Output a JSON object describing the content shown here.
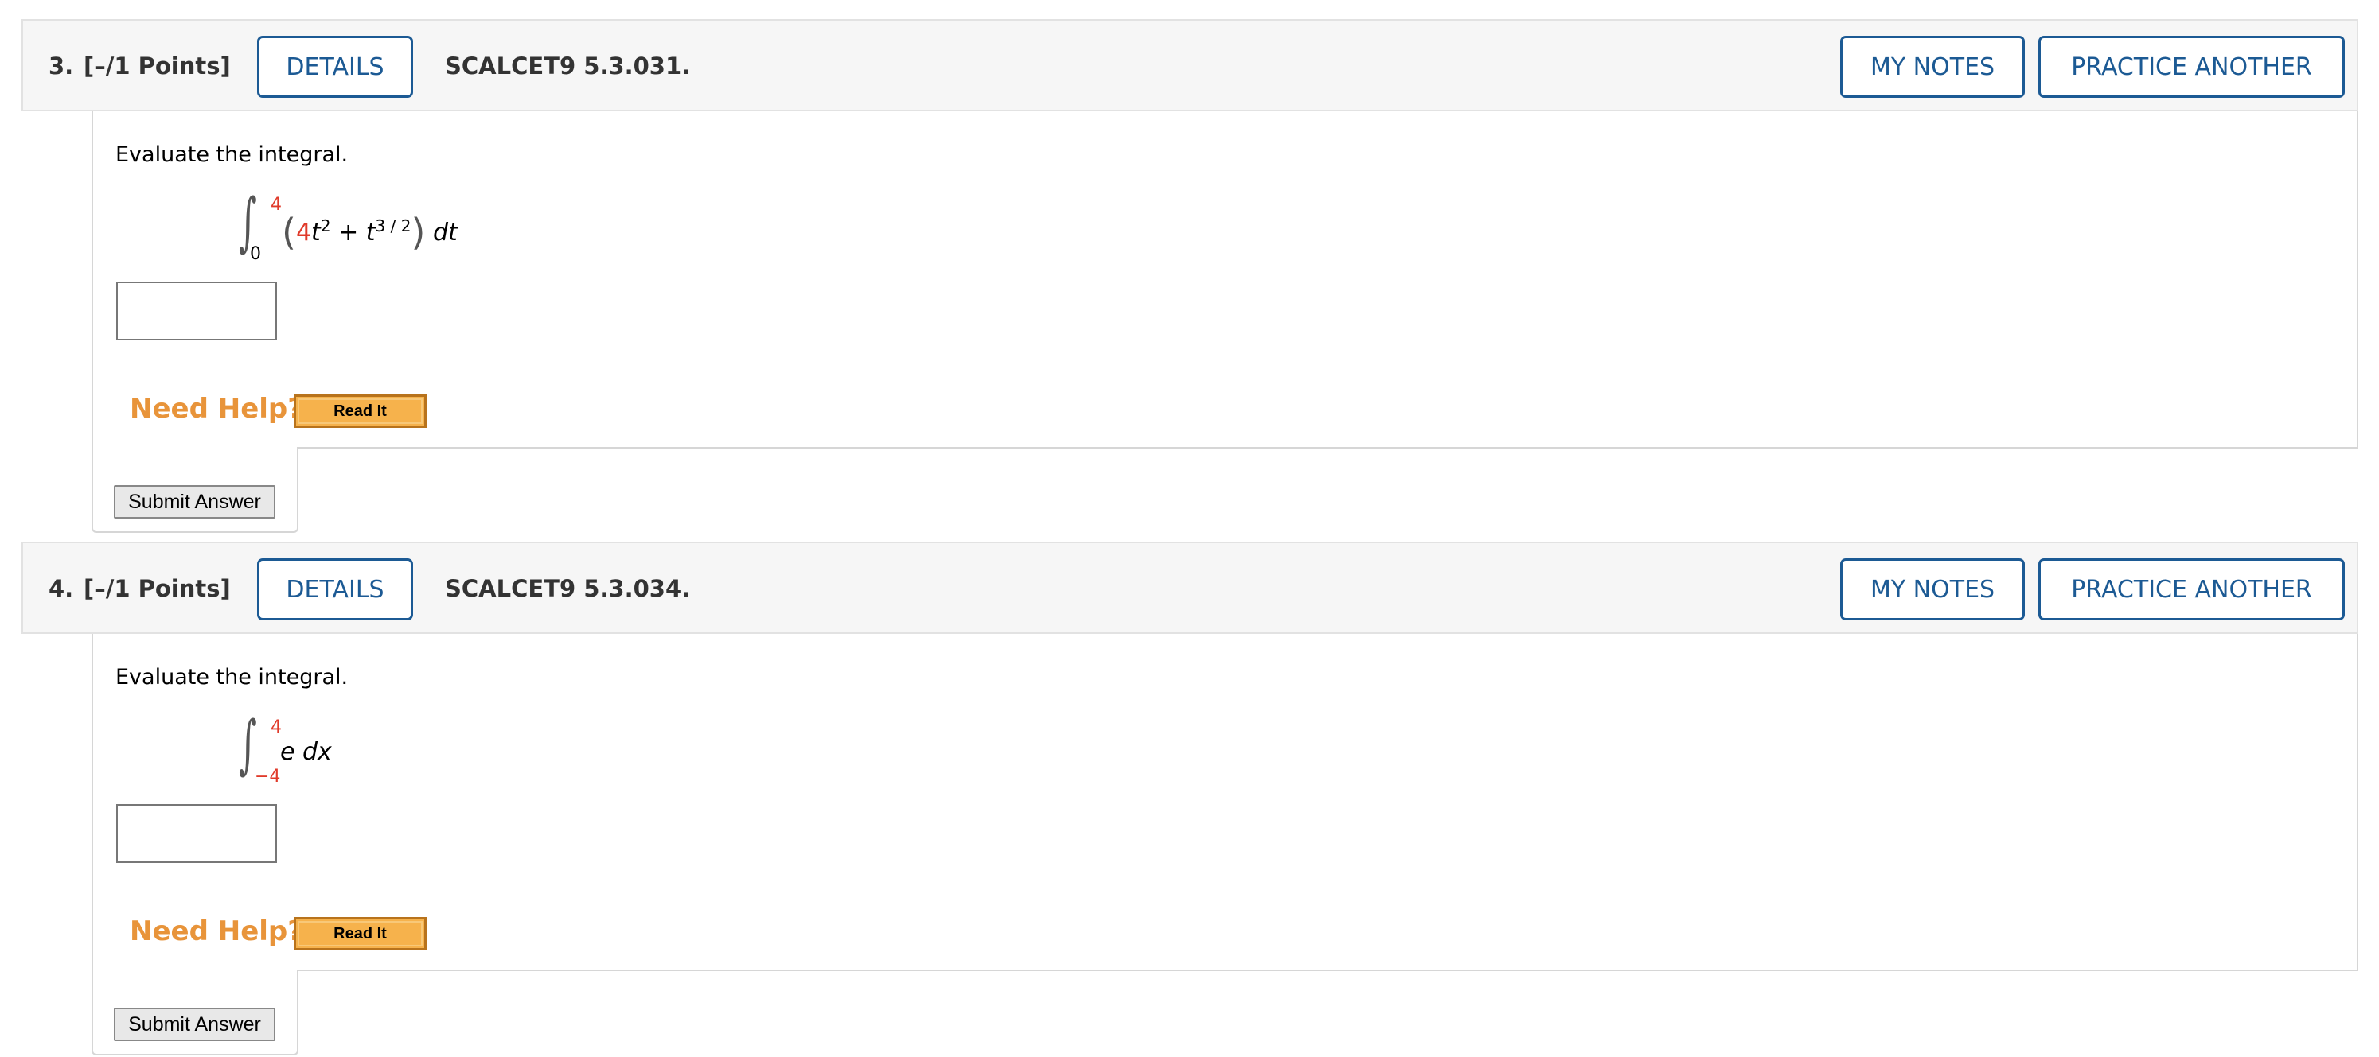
{
  "questions": [
    {
      "number": "3.",
      "points": "[–/1 Points]",
      "details_label": "DETAILS",
      "code": "SCALCET9 5.3.031.",
      "my_notes_label": "MY NOTES",
      "practice_label": "PRACTICE ANOTHER",
      "prompt": "Evaluate the integral.",
      "integral": {
        "upper": "4",
        "lower": "0",
        "coef": "4",
        "var_t": "t",
        "exp2": "2",
        "plus": " + ",
        "var_t2": "t",
        "exp32": "3 / 2",
        "differential": "dt"
      },
      "answer_value": "",
      "need_help_label": "Need Help?",
      "read_it_label": "Read It",
      "submit_label": "Submit Answer"
    },
    {
      "number": "4.",
      "points": "[–/1 Points]",
      "details_label": "DETAILS",
      "code": "SCALCET9 5.3.034.",
      "my_notes_label": "MY NOTES",
      "practice_label": "PRACTICE ANOTHER",
      "prompt": "Evaluate the integral.",
      "integral": {
        "upper": "4",
        "lower": "−4",
        "integrand": "e",
        "differential": "dx"
      },
      "answer_value": "",
      "need_help_label": "Need Help?",
      "read_it_label": "Read It",
      "submit_label": "Submit Answer"
    }
  ],
  "colors": {
    "accent_blue": "#1c5a94",
    "help_orange": "#e8943a",
    "param_red": "#e03a2a",
    "header_bg": "#f6f6f6"
  }
}
